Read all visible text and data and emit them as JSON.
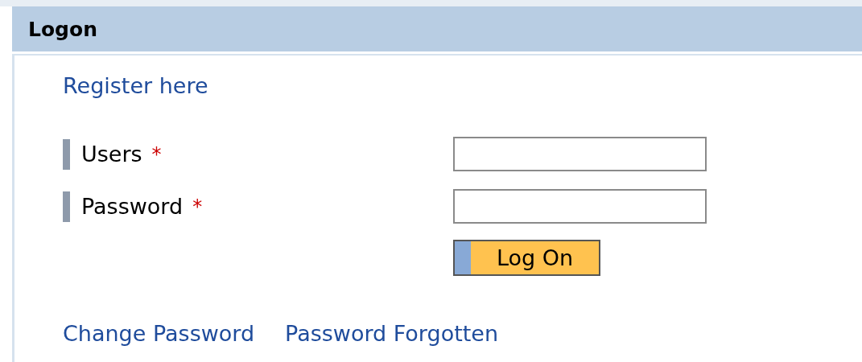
{
  "header": {
    "title": "Logon"
  },
  "register_link": "Register here",
  "fields": [
    {
      "label": "Users",
      "required": true,
      "required_mark": "*"
    },
    {
      "label": "Password",
      "required": true,
      "required_mark": "*"
    }
  ],
  "button": "Log On",
  "links": [
    "Change Password",
    "Password Forgotten"
  ]
}
